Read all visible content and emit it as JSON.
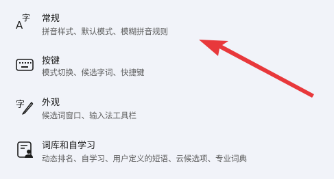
{
  "settings_list": {
    "items": [
      {
        "icon": "text-font-icon",
        "title": "常规",
        "description": "拼音样式、默认模式、模糊拼音规则"
      },
      {
        "icon": "keyboard-icon",
        "title": "按键",
        "description": "模式切换、候选字词、快捷键"
      },
      {
        "icon": "pen-character-icon",
        "title": "外观",
        "description": "候选词窗口、输入法工具栏"
      },
      {
        "icon": "user-dictionary-icon",
        "title": "词库和自学习",
        "description": "动态排名、自学习、用户定义的短语、云候选项、专业词典"
      }
    ]
  },
  "annotation": {
    "arrow_color": "#e8383b",
    "icon": "red-arrow-icon"
  }
}
